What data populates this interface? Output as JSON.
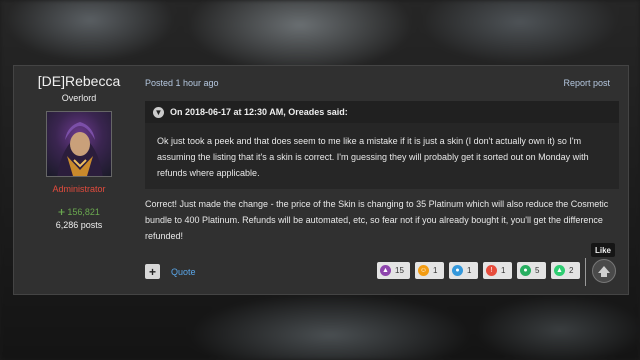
{
  "author": {
    "name": "[DE]Rebecca",
    "rank": "Overlord",
    "role": "Administrator",
    "reputation": "156,821",
    "posts": "6,286 posts",
    "role_color": "#e24b3d",
    "rep_color": "#6aa84f"
  },
  "post": {
    "posted": "Posted 1 hour ago",
    "report": "Report post",
    "quote_header": "On 2018-06-17 at 12:30 AM, Oreades said:",
    "quote_text": "Ok just took a peek and that does seem to me like a mistake if it is just a skin (I don't actually own it) so I'm assuming the listing that it's a skin is correct. I'm guessing they will probably get it sorted out on Monday with refunds where applicable.",
    "reply_text": "Correct! Just made the change - the price of the Skin is changing to 35 Platinum which will also reduce the Cosmetic bundle to 400 Platinum. Refunds will be automated, etc, so fear not if you already bought it, you'll get the difference refunded!"
  },
  "actions": {
    "plus": "+",
    "quote": "Quote",
    "like_tooltip": "Like"
  },
  "reactions": [
    {
      "icon": "purple-reaction-icon",
      "color": "#8e44ad",
      "count": "15"
    },
    {
      "icon": "orange-reaction-icon",
      "color": "#f39c12",
      "count": "1"
    },
    {
      "icon": "blue-reaction-icon",
      "color": "#3498db",
      "count": "1"
    },
    {
      "icon": "red-reaction-icon",
      "color": "#e74c3c",
      "count": "1"
    },
    {
      "icon": "green-reaction-icon",
      "color": "#27ae60",
      "count": "5"
    },
    {
      "icon": "green-up-reaction-icon",
      "color": "#2ecc71",
      "count": "2"
    }
  ]
}
